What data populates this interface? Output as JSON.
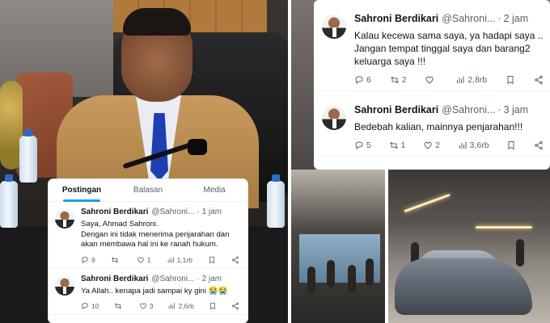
{
  "left_card": {
    "tabs": [
      "Postingan",
      "Balasan",
      "Media"
    ],
    "tweets": [
      {
        "name": "Sahroni Berdikari",
        "handle": "@Sahroni...",
        "time": "1 jam",
        "text": "Saya, Ahmad Sahroni.\nDengan ini tidak menerima penjarahan dan akan membawa hal ini ke ranah hukum.",
        "replies": "9",
        "retweets": "",
        "likes": "1",
        "views": "1,1rb"
      },
      {
        "name": "Sahroni Berdikari",
        "handle": "@Sahroni...",
        "time": "2 jam",
        "text": "Ya Allah.. kenapa jadi sampai ky gini 😭😭",
        "replies": "10",
        "retweets": "",
        "likes": "3",
        "views": "2,6rb"
      }
    ]
  },
  "right_card": {
    "tweets": [
      {
        "name": "Sahroni Berdikari",
        "handle": "@Sahroni...",
        "time": "2 jam",
        "text": "Kalau kecewa sama saya, ya hadapi saya ..\nJangan tempat tinggal saya dan barang2 keluarga saya !!!",
        "replies": "6",
        "retweets": "2",
        "likes": "",
        "views": "2,8rb"
      },
      {
        "name": "Sahroni Berdikari",
        "handle": "@Sahroni...",
        "time": "3 jam",
        "text": "Bedebah kalian, mainnya penjarahan!!!",
        "replies": "5",
        "retweets": "1",
        "likes": "2",
        "views": "3,6rb"
      }
    ]
  },
  "colors": {
    "accent": "#1d9bf0",
    "text_primary": "#0f1419",
    "text_secondary": "#536471",
    "divider": "#eff3f4"
  },
  "icons": [
    "reply-icon",
    "retweet-icon",
    "like-icon",
    "views-icon",
    "bookmark-icon",
    "share-icon"
  ]
}
